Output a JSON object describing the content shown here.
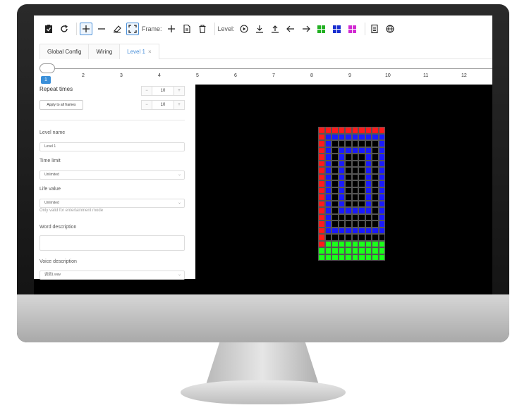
{
  "toolbar": {
    "frame_label": "Frame:",
    "level_label": "Level:",
    "icons": [
      "clipboard-check-icon",
      "refresh-icon",
      "plus-icon",
      "minus-icon",
      "eraser-icon",
      "fullscreen-icon",
      "add-frame-icon",
      "document-icon",
      "trash-icon",
      "play-icon",
      "download-icon",
      "upload-icon",
      "arrow-left-icon",
      "arrow-right-icon",
      "green-grid-icon",
      "blue-grid-icon",
      "magenta-grid-icon",
      "notes-icon",
      "globe-icon"
    ]
  },
  "tabs": [
    {
      "label": "Global Config"
    },
    {
      "label": "Wiring"
    },
    {
      "label": "Level 1",
      "close": "×"
    }
  ],
  "timeline": {
    "badge": "1",
    "ticks": [
      "2",
      "3",
      "4",
      "5",
      "6",
      "7",
      "8",
      "9",
      "10",
      "11",
      "12"
    ]
  },
  "panel": {
    "repeat_label": "Repeat times",
    "repeat_value": "10",
    "apply_label": "Apply to all frames",
    "apply_value": "10",
    "level_name_label": "Level name",
    "level_name_value": "Level 1",
    "time_limit_label": "Time limit",
    "time_limit_value": "Unlimited",
    "life_value_label": "Life value",
    "life_value_value": "Unlimited",
    "life_hint": "Only valid for entertainment mode",
    "word_description_label": "Word description",
    "voice_description_label": "Voice description",
    "voice_value": "调调1.wav"
  },
  "colors": {
    "accent": "#3a8fd9",
    "red": "#ff1a1a",
    "blue": "#1a1aff",
    "black": "#000000",
    "green": "#1aff1a"
  },
  "matrix": {
    "rows": [
      "RRRRRRRRRR",
      "RBBBBBBBBB",
      "RBKKKKKKKB",
      "RBKBBBBBKB",
      "RBKBKKKBKB",
      "RBKBKKKBKB",
      "RBKBKKKBKB",
      "RBKBKKKBKB",
      "RBKBKKKBKB",
      "RBKBKKKBKB",
      "RBKBKKKBKB",
      "RBKBKKKBKB",
      "RBKBBBBBKB",
      "RBKKKKKKKB",
      "RBKKKKKKKB",
      "RBBBBBBBBB",
      "RKKKKKKKKK",
      "RGGGGGGGGG",
      "GGGGGGGGGG",
      "GGGGGGGGGG"
    ]
  }
}
